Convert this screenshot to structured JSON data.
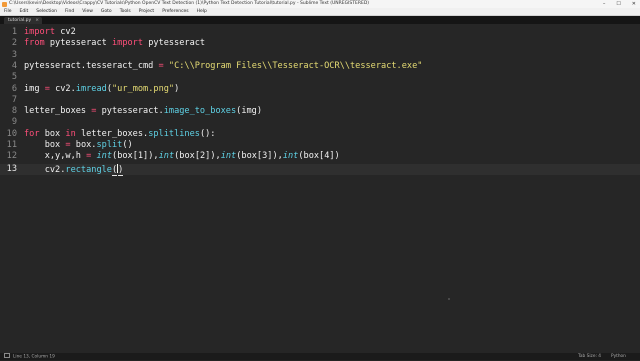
{
  "window": {
    "title": "C:\\Users\\kevin\\Desktop\\Videos\\Crappy\\CV Tutorials\\Python OpenCV Text Detection (1)\\Python Text Detection Tutorial\\tutorial.py - Sublime Text (UNREGISTERED)",
    "controls": [
      "–",
      "☐",
      "✕"
    ]
  },
  "menu": [
    "File",
    "Edit",
    "Selection",
    "Find",
    "View",
    "Goto",
    "Tools",
    "Project",
    "Preferences",
    "Help"
  ],
  "tab": {
    "label": "tutorial.py",
    "close": "×"
  },
  "editor": {
    "line_numbers": [
      "1",
      "2",
      "3",
      "4",
      "5",
      "6",
      "7",
      "8",
      "9",
      "10",
      "11",
      "12",
      "13"
    ],
    "active_line": "13"
  },
  "code": {
    "l1": {
      "kw": "import",
      "rest": " cv2"
    },
    "l2": {
      "kw1": "from",
      "mid": " pytesseract ",
      "kw2": "import",
      "rest": " pytesseract"
    },
    "l4": {
      "lhs": "pytesseract.tesseract_cmd ",
      "eq": "=",
      "sp": " ",
      "str": "\"C:\\\\Program Files\\\\Tesseract-OCR\\\\tesseract.exe\""
    },
    "l6": {
      "lhs": "img ",
      "eq": "=",
      "mid": " cv2.",
      "fn": "imread",
      "open": "(",
      "str": "\"ur_mom.png\"",
      "close": ")"
    },
    "l8": {
      "lhs": "letter_boxes ",
      "eq": "=",
      "mid": " pytesseract.",
      "fn": "image_to_boxes",
      "rest": "(img)"
    },
    "l10": {
      "kw1": "for",
      "mid": " box ",
      "kw2": "in",
      "mid2": " letter_boxes.",
      "fn": "splitlines",
      "rest": "():"
    },
    "l11": {
      "indent": "    ",
      "lhs": "box ",
      "eq": "=",
      "mid": " box.",
      "fn": "split",
      "rest": "()"
    },
    "l12": {
      "indent": "    ",
      "lhs": "x,y,w,h ",
      "eq": "=",
      "sp": " ",
      "c1": "int",
      "a1": "(box[1]),",
      "c2": "int",
      "a2": "(box[2]),",
      "c3": "int",
      "a3": "(box[3]),",
      "c4": "int",
      "a4": "(box[4])"
    },
    "l13": {
      "indent": "    ",
      "mid": "cv2.",
      "fn": "rectangle",
      "open": "(",
      "close": ")"
    }
  },
  "status": {
    "position": "Line 13, Column 19",
    "tab_size": "Tab Size: 4",
    "syntax": "Python"
  },
  "colors": {
    "background": "#262626",
    "keyword": "#ff4f7a",
    "function": "#5fd2e6",
    "string": "#e6dc74",
    "text": "#f2f2f2"
  }
}
